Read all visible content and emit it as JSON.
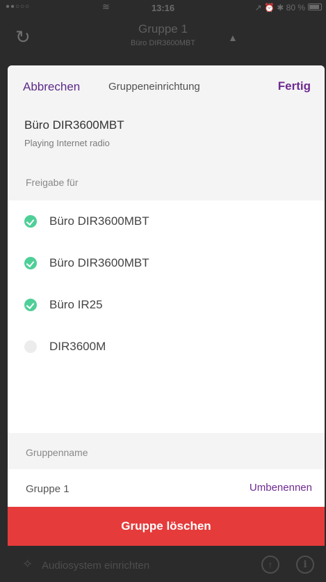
{
  "status_bar": {
    "signal": "●●○○○",
    "time": "13:16",
    "right": "↗ ⏰ ✱ 80 %"
  },
  "background": {
    "title": "Gruppe 1",
    "subtitle": "Büro DIR3600MBT",
    "footer_label": "Audiosystem einrichten"
  },
  "sheet": {
    "cancel_label": "Abbrechen",
    "title": "Gruppeneinrichtung",
    "done_label": "Fertig",
    "device_name": "Büro DIR3600MBT",
    "device_status": "Playing Internet radio",
    "share_label": "Freigabe für",
    "devices": [
      {
        "name": "Büro DIR3600MBT",
        "selected": true
      },
      {
        "name": "Büro DIR3600MBT",
        "selected": true
      },
      {
        "name": "Büro IR25",
        "selected": true
      },
      {
        "name": "DIR3600M",
        "selected": false
      }
    ],
    "group_name_label": "Gruppenname",
    "group_name": "Gruppe 1",
    "rename_label": "Umbenennen",
    "delete_label": "Gruppe löschen"
  },
  "colors": {
    "accent": "#6e2a91",
    "check": "#4fcf98",
    "delete": "#e63b3b"
  }
}
